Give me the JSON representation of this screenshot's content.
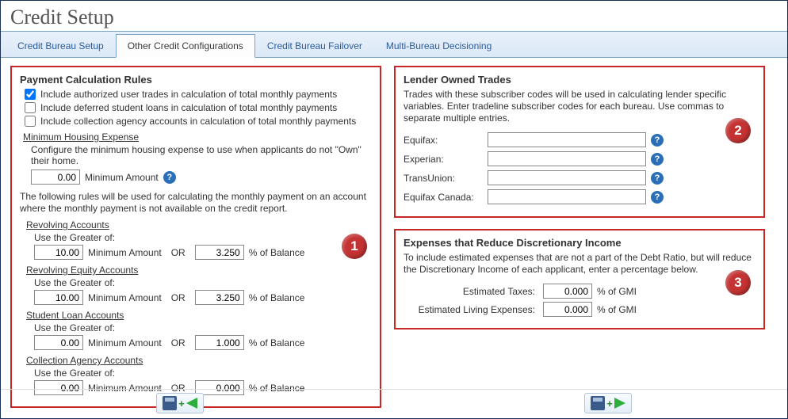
{
  "page_title": "Credit Setup",
  "tabs": {
    "t0": "Credit Bureau Setup",
    "t1": "Other Credit Configurations",
    "t2": "Credit Bureau Failover",
    "t3": "Multi-Bureau Decisioning"
  },
  "panels": {
    "payment_calc": {
      "title": "Payment Calculation Rules",
      "chk1": "Include authorized user trades in calculation of total monthly payments",
      "chk2": "Include deferred student loans in calculation of total monthly payments",
      "chk3": "Include collection agency accounts in calculation of total monthly payments",
      "min_housing_heading": "Minimum Housing Expense",
      "min_housing_desc": "Configure the minimum housing expense to use when applicants do not \"Own\" their home.",
      "min_housing_value": "0.00",
      "min_amount_label": "Minimum Amount",
      "rules_desc": "The following rules will be used for calculating the monthly payment on an account where the monthly payment is not available on the credit report.",
      "use_greater": "Use the Greater of:",
      "or": "OR",
      "pct_balance_label": "% of Balance",
      "accounts": {
        "revolving": {
          "heading": "Revolving Accounts",
          "min": "10.00",
          "pct": "3.250"
        },
        "rev_equity": {
          "heading": "Revolving Equity Accounts",
          "min": "10.00",
          "pct": "3.250"
        },
        "student": {
          "heading": "Student Loan Accounts",
          "min": "0.00",
          "pct": "1.000"
        },
        "collection": {
          "heading": "Collection Agency Accounts",
          "min": "0.00",
          "pct": "0.000"
        }
      },
      "badge": "1"
    },
    "lender": {
      "title": "Lender Owned Trades",
      "desc": "Trades with these subscriber codes will be used in calculating lender specific variables. Enter tradeline subscriber codes for each bureau.  Use commas to separate multiple entries.",
      "equifax": "Equifax:",
      "experian": "Experian:",
      "transunion": "TransUnion:",
      "equifax_canada": "Equifax Canada:",
      "vals": {
        "equifax": "",
        "experian": "",
        "transunion": "",
        "equifax_canada": ""
      },
      "badge": "2"
    },
    "expenses": {
      "title": "Expenses that Reduce Discretionary Income",
      "desc": "To include estimated expenses that are not a part of the Debt Ratio, but will reduce the Discretionary Income of each applicant, enter a percentage below.",
      "taxes_label": "Estimated Taxes:",
      "living_label": "Estimated Living Expenses:",
      "pct_gmi": "% of GMI",
      "taxes_val": "0.000",
      "living_val": "0.000",
      "badge": "3"
    }
  },
  "help_glyph": "?"
}
